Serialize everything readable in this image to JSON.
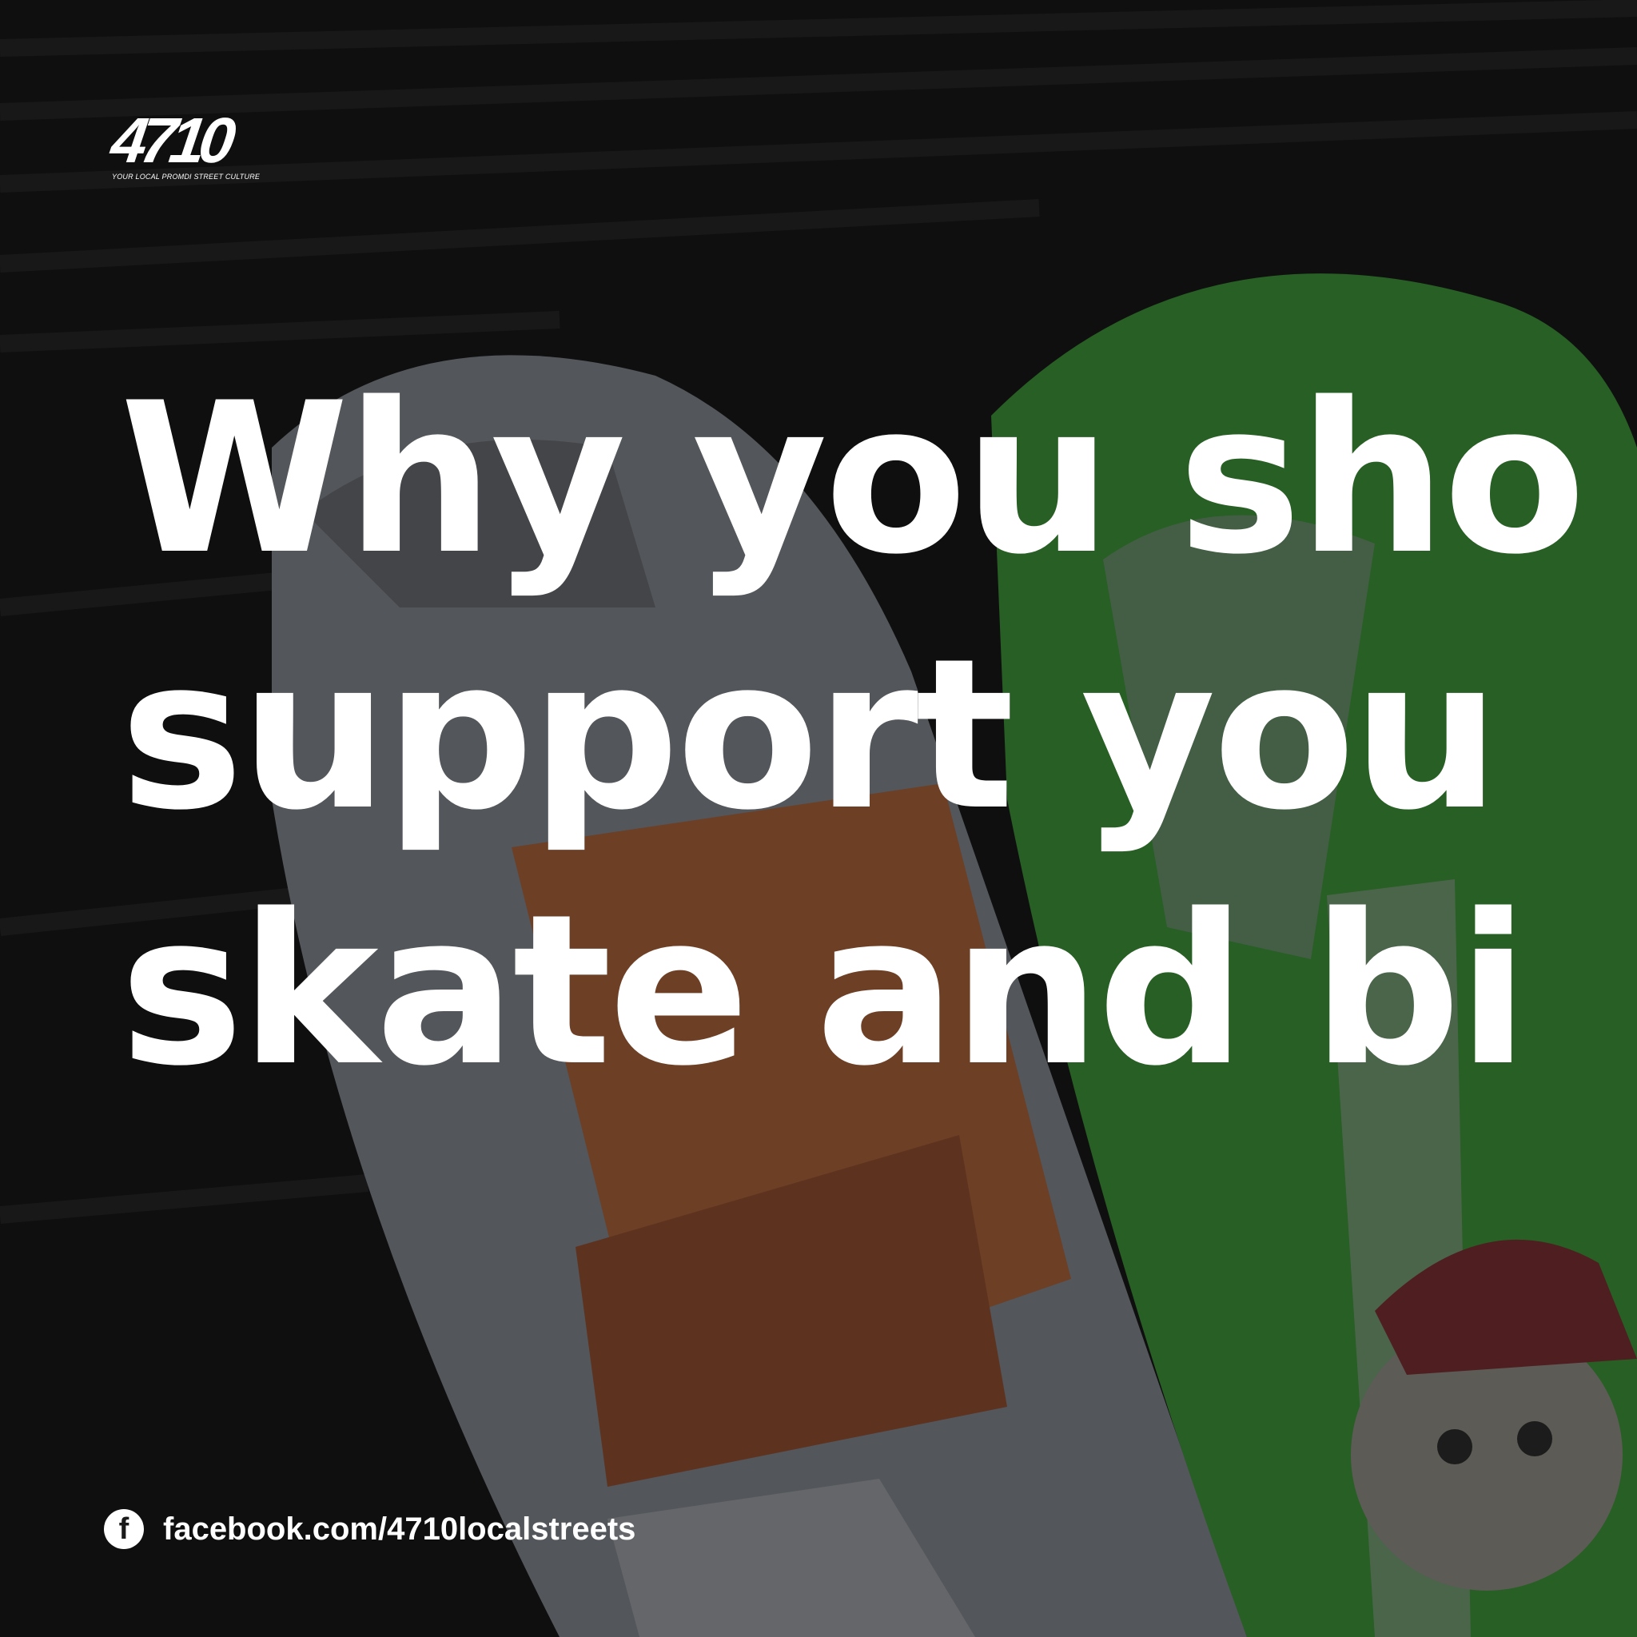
{
  "brand": {
    "logo_text": "4710",
    "tagline": "YOUR LOCAL PROMDI STREET CULTURE"
  },
  "headline": {
    "line1": "Why you sho",
    "line2": "support you",
    "line3": "skate and bi"
  },
  "social": {
    "icon": "facebook-icon",
    "url": "facebook.com/4710localstreets"
  },
  "colors": {
    "text": "#ffffff",
    "background": "#141414",
    "board_green": "#3f9a3c",
    "board_grey": "#8a8d91",
    "board_orange": "#b0653a"
  }
}
